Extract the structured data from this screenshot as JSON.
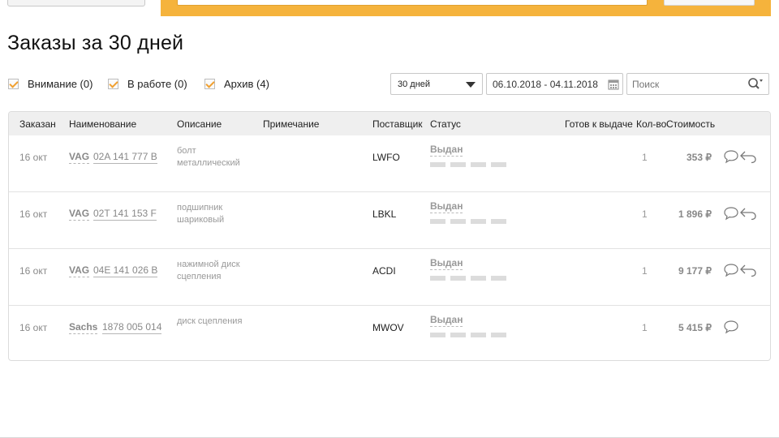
{
  "page": {
    "title": "Заказы за 30 дней"
  },
  "filters": [
    {
      "label": "Внимание (0)",
      "checked": true
    },
    {
      "label": "В работе (0)",
      "checked": true
    },
    {
      "label": "Архив (4)",
      "checked": true
    }
  ],
  "period": {
    "selected": "30 дней"
  },
  "date_range": {
    "value": "06.10.2018 - 04.11.2018"
  },
  "search": {
    "placeholder": "Поиск"
  },
  "table": {
    "headers": {
      "ordered": "Заказан",
      "name": "Наименование",
      "description": "Описание",
      "note": "Примечание",
      "supplier": "Поставщик",
      "status": "Статус",
      "ready": "Готов к выдаче",
      "qty": "Кол-во",
      "cost": "Стоимость"
    },
    "rows": [
      {
        "date": "16 окт",
        "brand": "VAG",
        "article": "02A 141 777 B",
        "description": "болт металлический",
        "supplier": "LWFO",
        "status": "Выдан",
        "qty": "1",
        "price": "353 ₽",
        "has_return": true
      },
      {
        "date": "16 окт",
        "brand": "VAG",
        "article": "02T 141 153 F",
        "description": "подшипник шариковый",
        "supplier": "LBKL",
        "status": "Выдан",
        "qty": "1",
        "price": "1 896 ₽",
        "has_return": true
      },
      {
        "date": "16 окт",
        "brand": "VAG",
        "article": "04E 141 026 B",
        "description": "нажимной диск сцепления",
        "supplier": "ACDI",
        "status": "Выдан",
        "qty": "1",
        "price": "9 177 ₽",
        "has_return": true
      },
      {
        "date": "16 окт",
        "brand": "Sachs",
        "article": "1878 005 014",
        "description": "диск сцепления",
        "supplier": "MWOV",
        "status": "Выдан",
        "qty": "1",
        "price": "5 415 ₽",
        "has_return": false
      }
    ]
  },
  "colors": {
    "accent": "#f5b33c",
    "check": "#f0a030",
    "header_bg": "#efefef"
  },
  "icons": [
    "calendar-icon",
    "search-icon",
    "comment-icon",
    "return-icon"
  ]
}
